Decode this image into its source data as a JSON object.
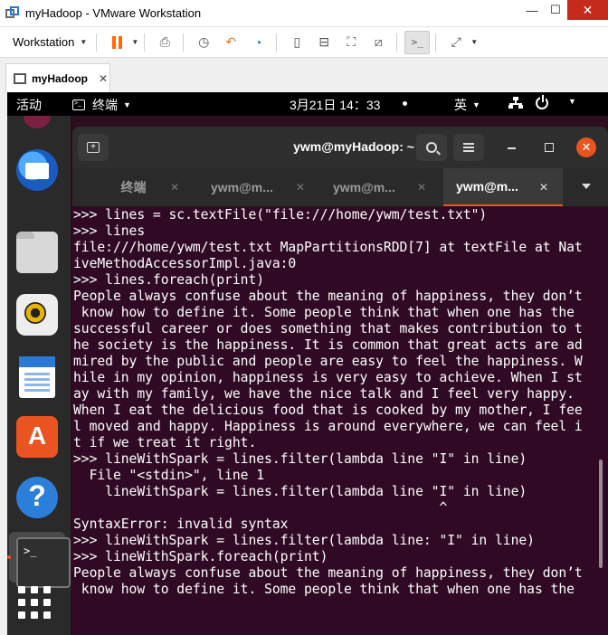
{
  "vmware": {
    "title": "myHadoop - VMware Workstation",
    "window_buttons": {
      "minimize": "—",
      "maximize": "☐",
      "close": "✕"
    },
    "toolbar": {
      "workstation_menu": "Workstation",
      "icons": [
        "pause-icon",
        "send-ctrl-alt-del-icon",
        "snapshot-icon",
        "revert-snapshot-icon",
        "snapshot-manager-icon",
        "sidebar-icon",
        "thumbnail-icon",
        "fullscreen-icon",
        "unity-icon",
        "console-icon",
        "stretch-icon"
      ],
      "accent_color": "#ff6a00"
    },
    "tab": {
      "label": "myHadoop",
      "close": "✕"
    }
  },
  "ubuntu": {
    "topbar": {
      "activities": "活动",
      "app_menu": "终端",
      "clock": "3月21日  14：33",
      "input_method": "英",
      "icons": [
        "network-icon",
        "power-icon",
        "system-menu-caret-icon"
      ]
    },
    "dock": {
      "apps": [
        "thunderbird-icon",
        "files-icon",
        "rhythmbox-icon",
        "libreoffice-writer-icon",
        "ubuntu-software-icon",
        "help-icon",
        "terminal-icon",
        "show-applications-icon"
      ],
      "running_indicator_color": "#e95420"
    },
    "terminal": {
      "title": "ywm@myHadoop: ~",
      "tabs": [
        {
          "label": "终端",
          "close": "✕"
        },
        {
          "label": "ywm@m...",
          "close": "✕"
        },
        {
          "label": "ywm@m...",
          "close": "✕"
        },
        {
          "label": "ywm@m...",
          "close": "✕",
          "active": true
        }
      ],
      "background_color": "#300a24",
      "lines": [
        ">>> lines = sc.textFile(\"file:///home/ywm/test.txt\")",
        ">>> lines",
        "file:///home/ywm/test.txt MapPartitionsRDD[7] at textFile at Nat",
        "iveMethodAccessorImpl.java:0",
        ">>> lines.foreach(print)",
        "People always confuse about the meaning of happiness, they don’t",
        " know how to define it. Some people think that when one has the",
        "successful career or does something that makes contribution to t",
        "he society is the happiness. It is common that great acts are ad",
        "mired by the public and people are easy to feel the happiness. W",
        "hile in my opinion, happiness is very easy to achieve. When I st",
        "ay with my family, we have the nice talk and I feel very happy.",
        "When I eat the delicious food that is cooked by my mother, I fee",
        "l moved and happy. Happiness is around everywhere, we can feel i",
        "t if we treat it right.",
        ">>> lineWithSpark = lines.filter(lambda line \"I\" in line)",
        "  File \"<stdin>\", line 1",
        "    lineWithSpark = lines.filter(lambda line \"I\" in line)",
        "                                              ^",
        "SyntaxError: invalid syntax",
        ">>> lineWithSpark = lines.filter(lambda line: \"I\" in line)",
        ">>> lineWithSpark.foreach(print)",
        "People always confuse about the meaning of happiness, they don’t",
        " know how to define it. Some people think that when one has the"
      ]
    }
  }
}
